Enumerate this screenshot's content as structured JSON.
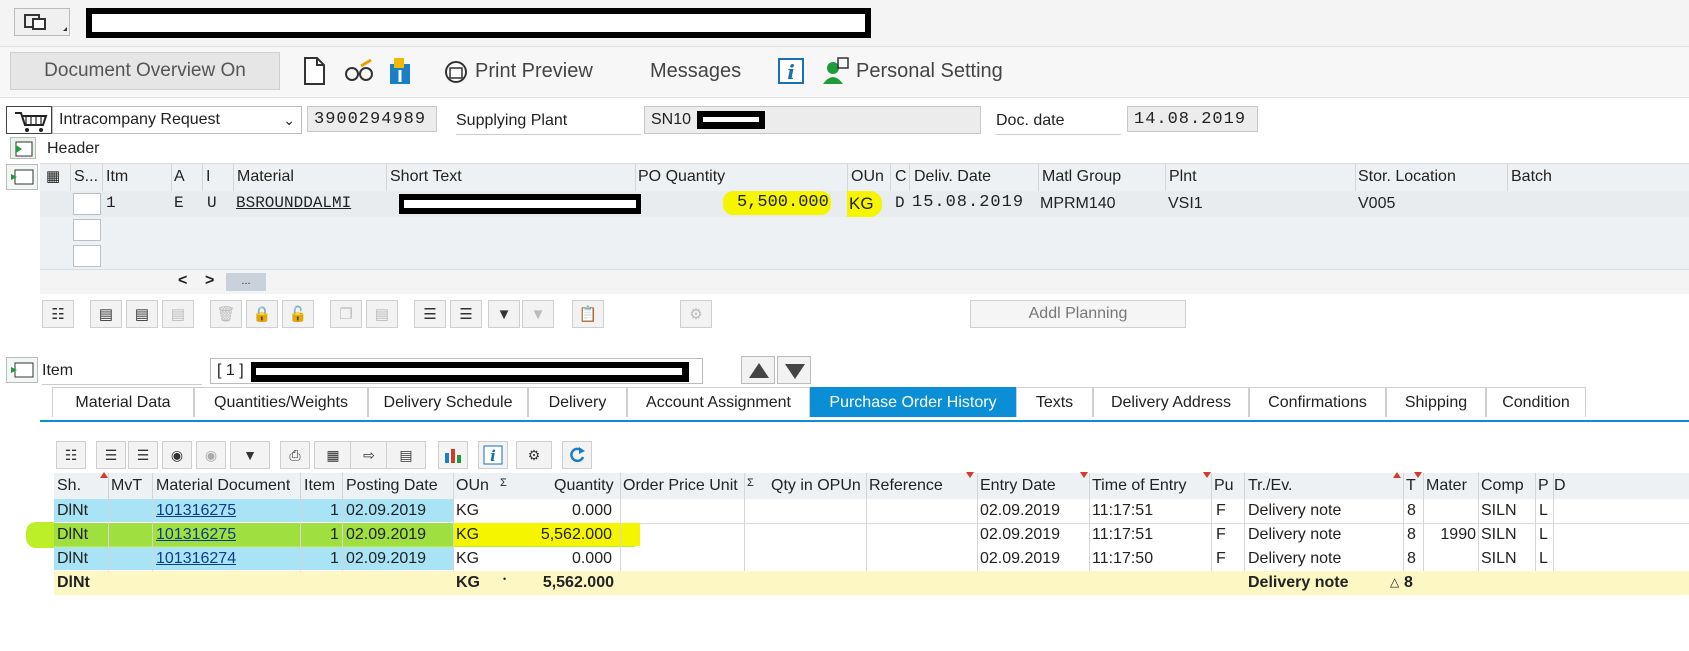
{
  "toolbar": {
    "document_overview": "Document Overview On",
    "print_preview": "Print Preview",
    "messages": "Messages",
    "personal_setting": "Personal Setting"
  },
  "header": {
    "doc_type": "Intracompany Request",
    "doc_number": "3900294989",
    "supplying_plant_label": "Supplying Plant",
    "supplying_plant_value": "SN10",
    "doc_date_label": "Doc. date",
    "doc_date_value": "14.08.2019",
    "section_label": "Header"
  },
  "item_grid": {
    "columns": [
      "S...",
      "Itm",
      "A",
      "I",
      "Material",
      "Short Text",
      "PO Quantity",
      "OUn",
      "C",
      "Deliv. Date",
      "Matl Group",
      "Plnt",
      "Stor. Location",
      "Batch"
    ],
    "row": {
      "itm": "1",
      "a": "E",
      "i": "U",
      "material": "BSROUNDDALMI",
      "po_quantity": "5,500.000",
      "oun": "KG",
      "c": "D",
      "deliv_date": "15.08.2019",
      "matl_group": "MPRM140",
      "plnt": "VSI1",
      "stor_location": "V005"
    },
    "scroll_left": "<",
    "scroll_right": ">",
    "scroll_thumb": "...",
    "addl_planning": "Addl Planning"
  },
  "item_section": {
    "label": "Item",
    "selector_value": "[ 1 ]"
  },
  "tabs": [
    "Material Data",
    "Quantities/Weights",
    "Delivery Schedule",
    "Delivery",
    "Account Assignment",
    "Purchase Order History",
    "Texts",
    "Delivery Address",
    "Confirmations",
    "Shipping",
    "Condition"
  ],
  "history": {
    "columns": [
      "Sh.",
      "MvT",
      "Material Document",
      "Item",
      "Posting Date",
      "OUn",
      "Σ",
      "Quantity",
      "Order Price Unit",
      "Σ",
      "Qty in OPUn",
      "Reference",
      "Entry Date",
      "Time of Entry",
      "Pu",
      "Tr./Ev.",
      "T",
      "Mater",
      "Comp",
      "P",
      "D"
    ],
    "rows": [
      {
        "sh": "DlNt",
        "doc": "101316275",
        "item": "1",
        "posting": "02.09.2019",
        "oun": "KG",
        "qty": "0.000",
        "entry": "02.09.2019",
        "time": "11:17:51",
        "pu": "F",
        "trev": "Delivery note",
        "t": "8",
        "mater": "",
        "comp": "SILN",
        "p": "L"
      },
      {
        "sh": "DlNt",
        "doc": "101316275",
        "item": "1",
        "posting": "02.09.2019",
        "oun": "KG",
        "qty": "5,562.000",
        "entry": "02.09.2019",
        "time": "11:17:51",
        "pu": "F",
        "trev": "Delivery note",
        "t": "8",
        "mater": "1990",
        "comp": "SILN",
        "p": "L"
      },
      {
        "sh": "DlNt",
        "doc": "101316274",
        "item": "1",
        "posting": "02.09.2019",
        "oun": "KG",
        "qty": "0.000",
        "entry": "02.09.2019",
        "time": "11:17:50",
        "pu": "F",
        "trev": "Delivery note",
        "t": "8",
        "mater": "",
        "comp": "SILN",
        "p": "L"
      }
    ],
    "total": {
      "sh": "DlNt",
      "oun": "KG",
      "dot": "•",
      "qty": "5,562.000",
      "trev": "Delivery note",
      "t": "8"
    }
  }
}
